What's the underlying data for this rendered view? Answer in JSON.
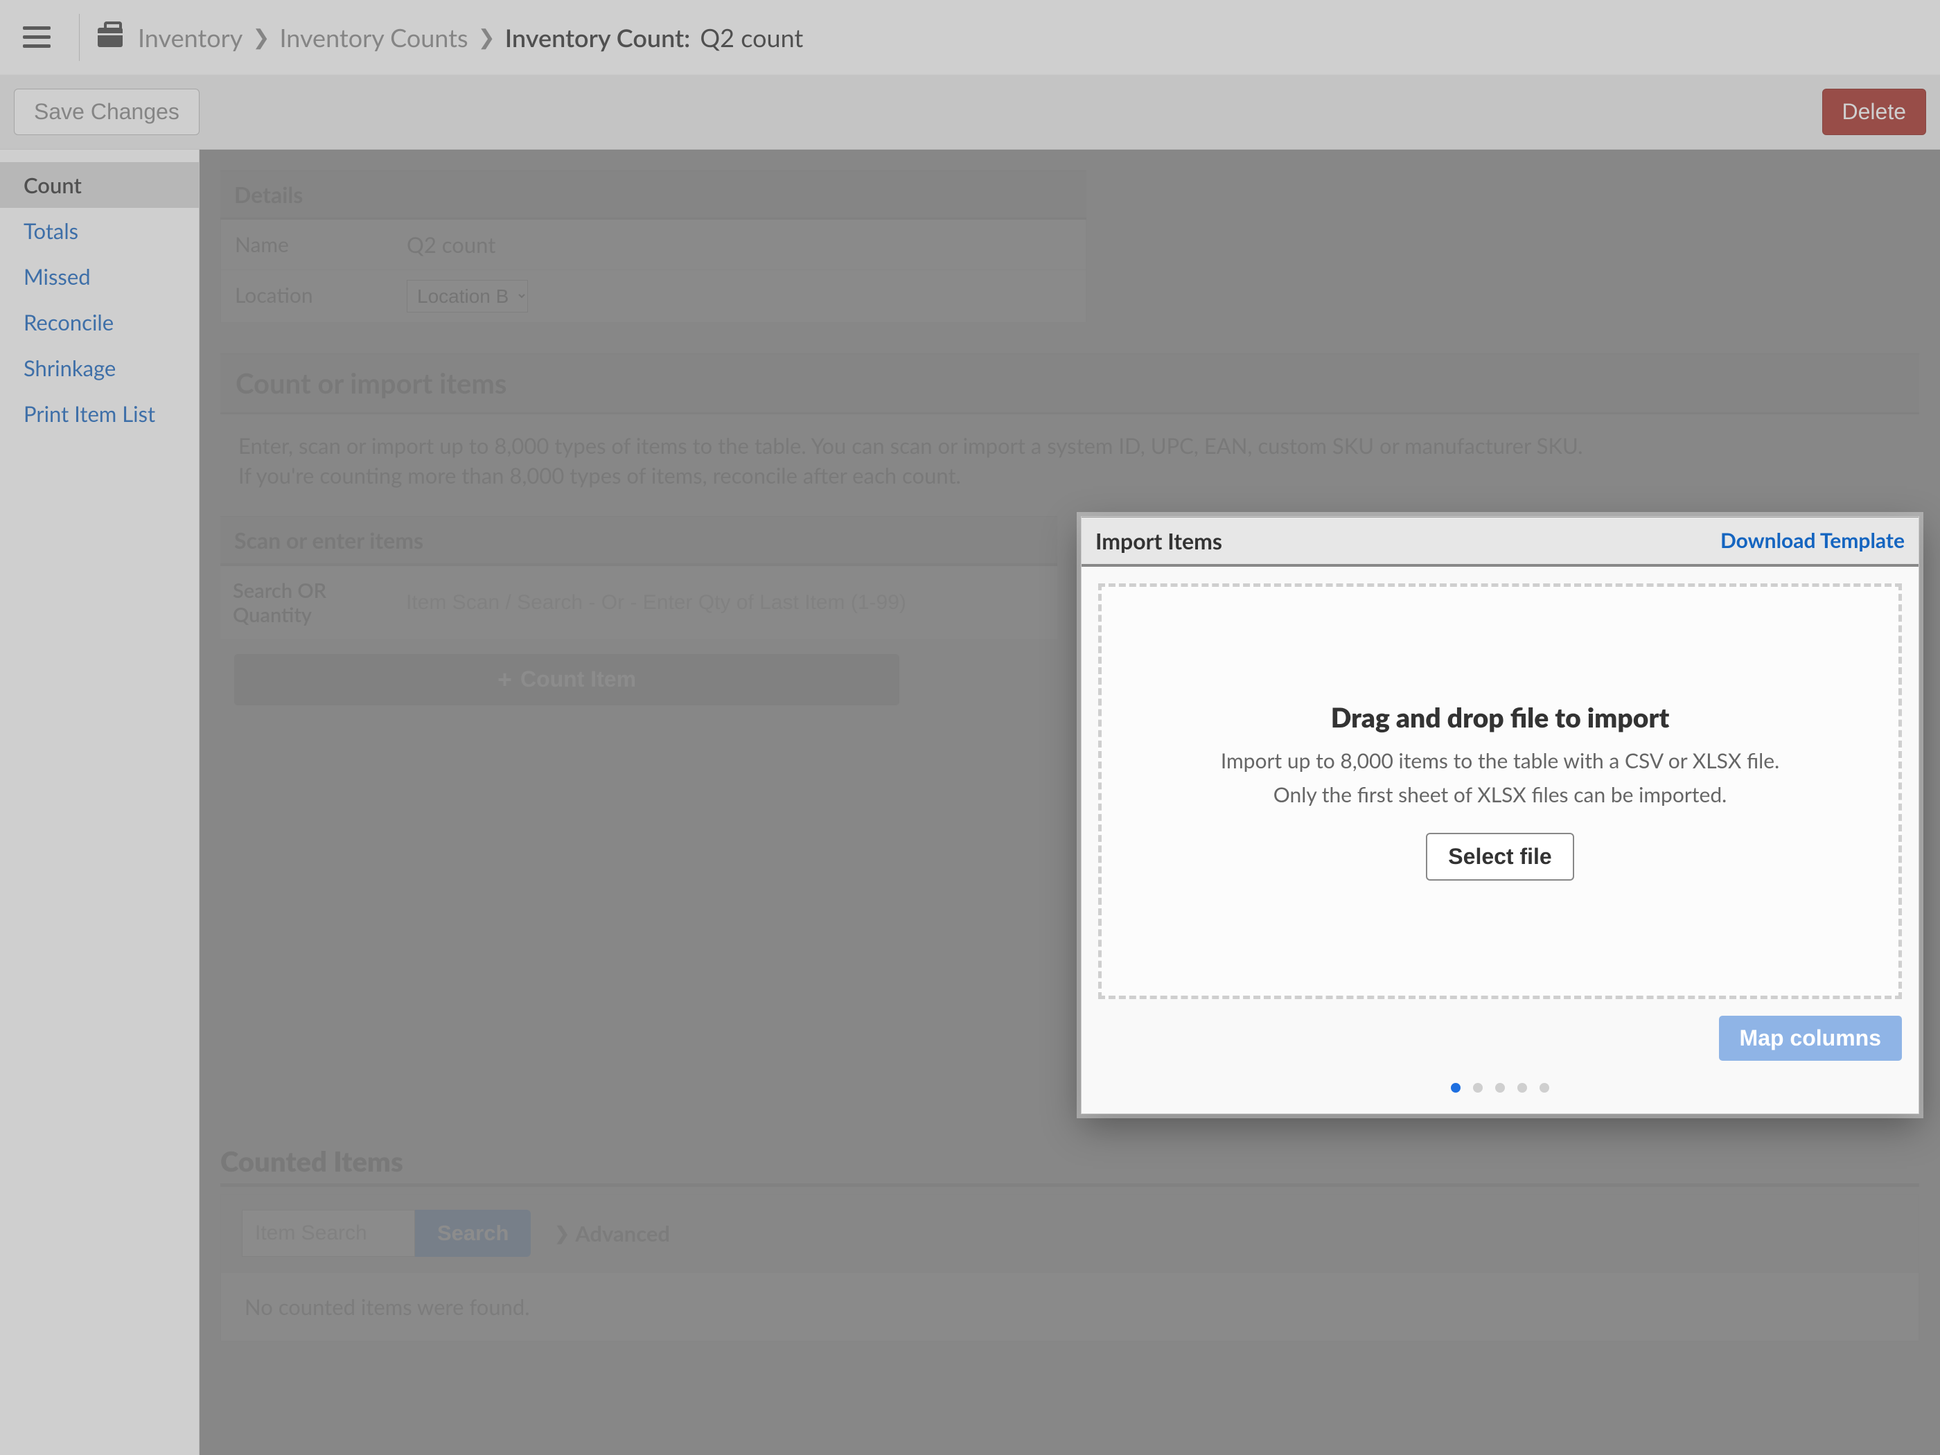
{
  "breadcrumb": {
    "root": "Inventory",
    "second": "Inventory Counts",
    "current_prefix": "Inventory Count:",
    "current_name": "Q2 count"
  },
  "actions": {
    "save": "Save Changes",
    "delete": "Delete"
  },
  "sidebar": {
    "items": [
      {
        "label": "Count",
        "active": true
      },
      {
        "label": "Totals",
        "active": false
      },
      {
        "label": "Missed",
        "active": false
      },
      {
        "label": "Reconcile",
        "active": false
      },
      {
        "label": "Shrinkage",
        "active": false
      },
      {
        "label": "Print Item List",
        "active": false
      }
    ]
  },
  "details": {
    "header": "Details",
    "name_label": "Name",
    "name_value": "Q2 count",
    "location_label": "Location",
    "location_value": "Location B"
  },
  "count_section": {
    "title": "Count or import items",
    "explain1": "Enter, scan or import up to 8,000 types of items to the table. You can scan or import a system ID, UPC, EAN, custom SKU or manufacturer SKU.",
    "explain2": "If you're counting more than 8,000 types of items, reconcile after each count."
  },
  "scan": {
    "header": "Scan or enter items",
    "field_label": "Search OR Quantity",
    "field_placeholder": "Item Scan / Search - Or - Enter Qty of Last Item (1-99)",
    "count_button": "Count Item"
  },
  "import": {
    "header": "Import Items",
    "download_link": "Download Template",
    "drop_title": "Drag and drop file to import",
    "drop_line1": "Import up to 8,000 items to the table with a CSV or XLSX file.",
    "drop_line2": "Only the first sheet of XLSX files can be imported.",
    "select_file": "Select file",
    "map_columns": "Map columns",
    "step_count": 5,
    "active_step": 0
  },
  "counted": {
    "title": "Counted Items",
    "search_placeholder": "Item Search",
    "search_button": "Search",
    "advanced": "Advanced",
    "empty": "No counted items were found."
  }
}
